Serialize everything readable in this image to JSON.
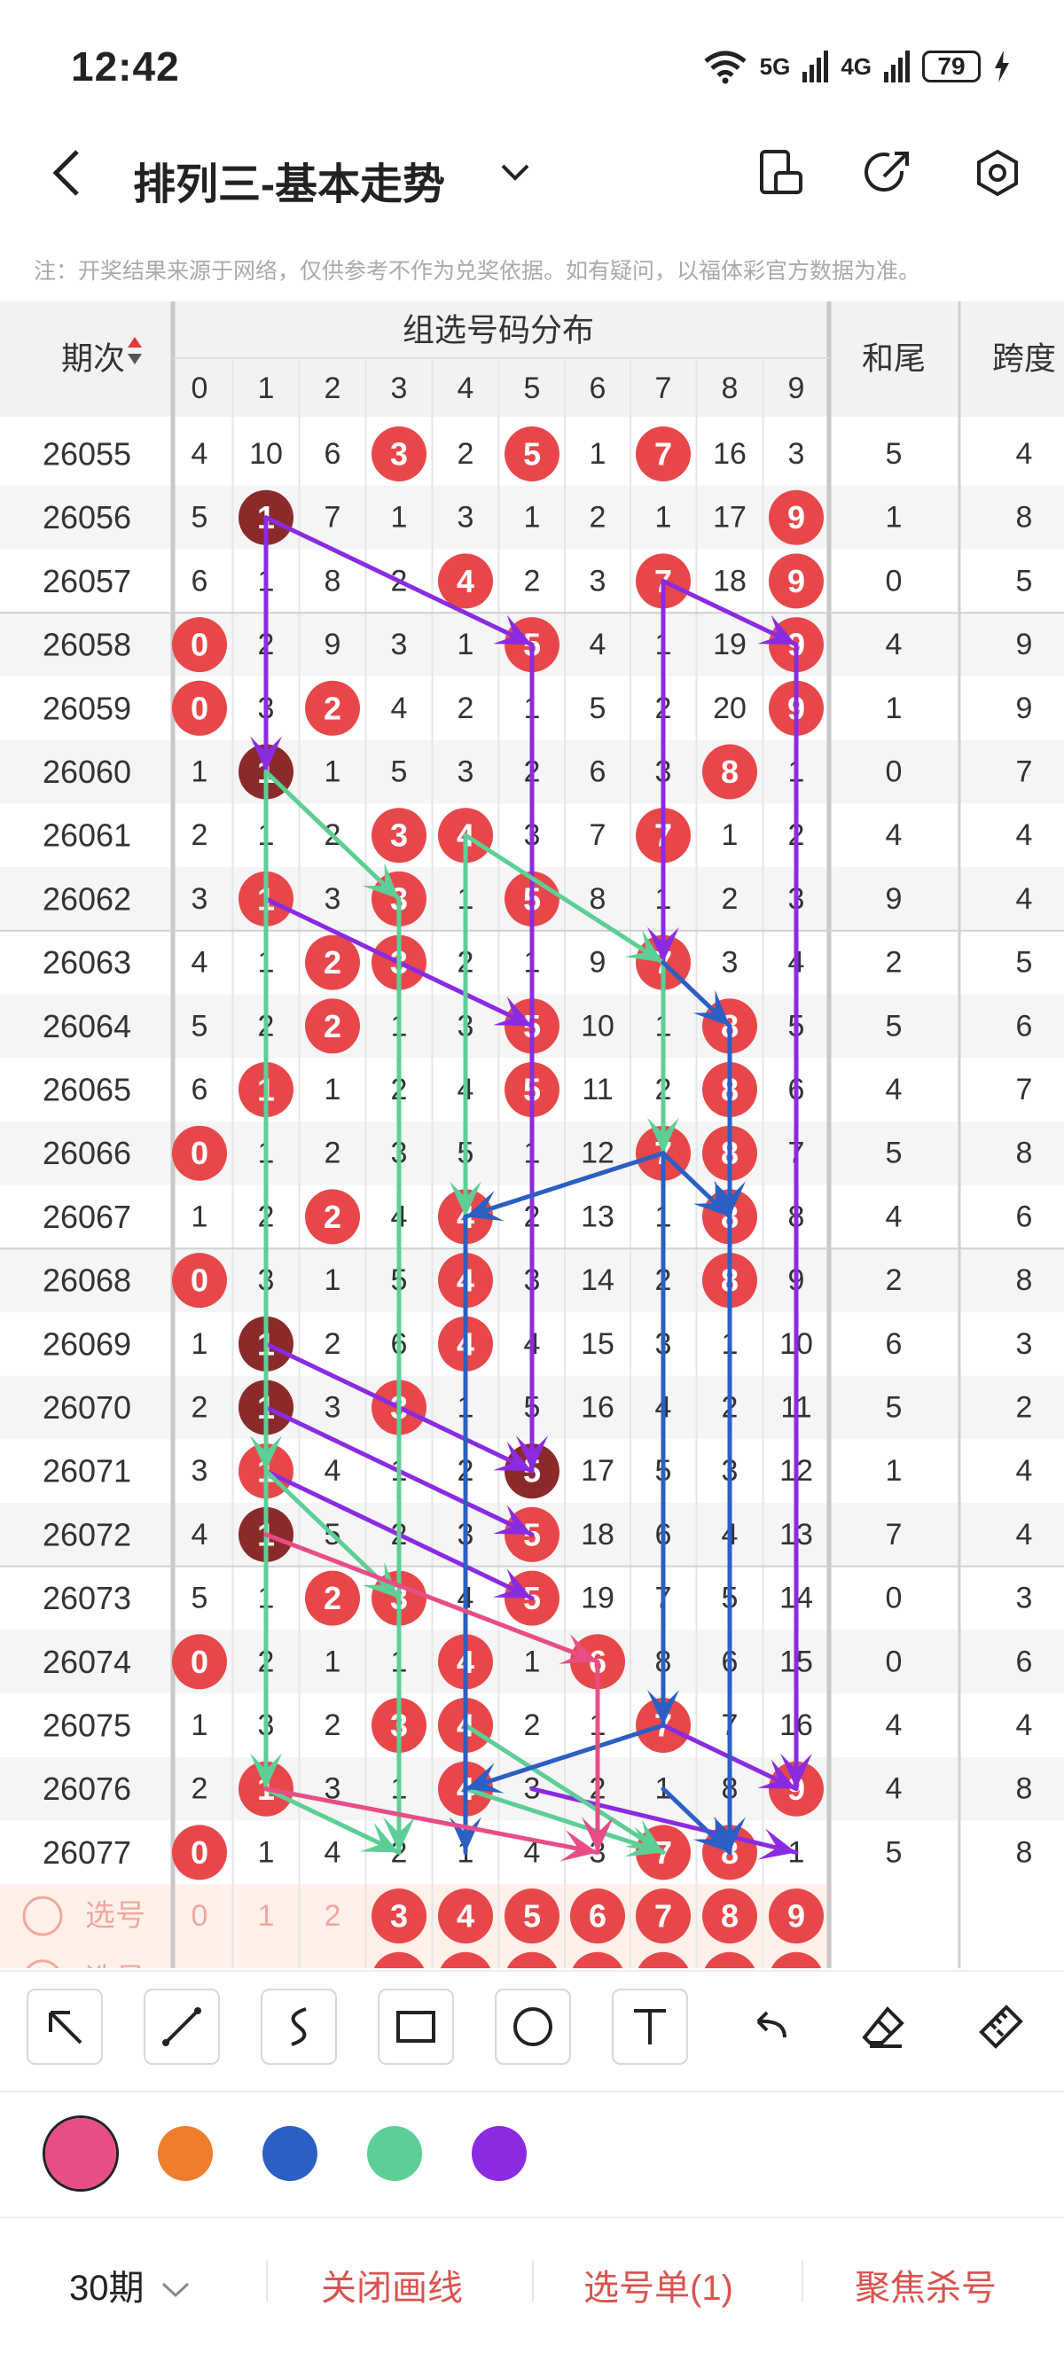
{
  "status": {
    "time": "12:42",
    "net1": "5G",
    "net2": "4G",
    "battery": "79"
  },
  "nav": {
    "title": "排列三-基本走势"
  },
  "disclaimer": "注：开奖结果来源于网络，仅供参考不作为兑奖依据。如有疑问，以福体彩官方数据为准。",
  "table": {
    "issue_header": "期次",
    "group_header": "组选号码分布",
    "sum_header": "和尾",
    "span_header": "跨度",
    "digits": [
      "0",
      "1",
      "2",
      "3",
      "4",
      "5",
      "6",
      "7",
      "8",
      "9"
    ],
    "rows": [
      {
        "issue": "26055",
        "cells": [
          4,
          10,
          6,
          "H",
          2,
          "H",
          1,
          "H",
          16,
          3
        ],
        "sum": 5,
        "span": 4
      },
      {
        "issue": "26056",
        "cells": [
          5,
          "D",
          7,
          1,
          3,
          1,
          2,
          1,
          17,
          "H"
        ],
        "sum": 1,
        "span": 8
      },
      {
        "issue": "26057",
        "cells": [
          6,
          1,
          8,
          2,
          "H",
          2,
          3,
          "H",
          18,
          "H"
        ],
        "sum": 0,
        "span": 5
      },
      {
        "issue": "26058",
        "cells": [
          "H",
          2,
          9,
          3,
          1,
          "H",
          4,
          1,
          19,
          "H"
        ],
        "sum": 4,
        "span": 9
      },
      {
        "issue": "26059",
        "cells": [
          "H",
          3,
          "H",
          4,
          2,
          1,
          5,
          2,
          20,
          "H"
        ],
        "sum": 1,
        "span": 9
      },
      {
        "issue": "26060",
        "cells": [
          1,
          "D",
          1,
          5,
          3,
          2,
          6,
          3,
          "H",
          1
        ],
        "sum": 0,
        "span": 7
      },
      {
        "issue": "26061",
        "cells": [
          2,
          1,
          2,
          "H",
          "H",
          3,
          7,
          "H",
          1,
          2
        ],
        "sum": 4,
        "span": 4
      },
      {
        "issue": "26062",
        "cells": [
          3,
          "H",
          3,
          "H",
          1,
          "H",
          8,
          1,
          2,
          3
        ],
        "sum": 9,
        "span": 4
      },
      {
        "issue": "26063",
        "cells": [
          4,
          1,
          "H",
          "H",
          2,
          1,
          9,
          "H",
          3,
          4
        ],
        "sum": 2,
        "span": 5
      },
      {
        "issue": "26064",
        "cells": [
          5,
          2,
          "H",
          1,
          3,
          "H",
          10,
          1,
          "H",
          5
        ],
        "sum": 5,
        "span": 6
      },
      {
        "issue": "26065",
        "cells": [
          6,
          "H",
          1,
          2,
          4,
          "H",
          11,
          2,
          "H",
          6
        ],
        "sum": 4,
        "span": 7
      },
      {
        "issue": "26066",
        "cells": [
          "H",
          1,
          2,
          3,
          5,
          1,
          12,
          "H",
          "H",
          7
        ],
        "sum": 5,
        "span": 8
      },
      {
        "issue": "26067",
        "cells": [
          1,
          2,
          "H",
          4,
          "H",
          2,
          13,
          1,
          "H",
          8
        ],
        "sum": 4,
        "span": 6
      },
      {
        "issue": "26068",
        "cells": [
          "H",
          3,
          1,
          5,
          "H",
          3,
          14,
          2,
          "H",
          9
        ],
        "sum": 2,
        "span": 8
      },
      {
        "issue": "26069",
        "cells": [
          1,
          "D",
          2,
          6,
          "H",
          4,
          15,
          3,
          1,
          10
        ],
        "sum": 6,
        "span": 3
      },
      {
        "issue": "26070",
        "cells": [
          2,
          "D",
          3,
          "H",
          1,
          5,
          16,
          4,
          2,
          11
        ],
        "sum": 5,
        "span": 2
      },
      {
        "issue": "26071",
        "cells": [
          3,
          "H",
          4,
          1,
          2,
          "D",
          17,
          5,
          3,
          12
        ],
        "sum": 1,
        "span": 4
      },
      {
        "issue": "26072",
        "cells": [
          4,
          "D",
          5,
          2,
          3,
          "H",
          18,
          6,
          4,
          13
        ],
        "sum": 7,
        "span": 4
      },
      {
        "issue": "26073",
        "cells": [
          5,
          1,
          "H",
          "H",
          4,
          "H",
          19,
          7,
          5,
          14
        ],
        "sum": 0,
        "span": 3
      },
      {
        "issue": "26074",
        "cells": [
          "H",
          2,
          1,
          1,
          "H",
          1,
          "H",
          8,
          6,
          15
        ],
        "sum": 0,
        "span": 6
      },
      {
        "issue": "26075",
        "cells": [
          1,
          3,
          2,
          "H",
          "H",
          2,
          1,
          "H",
          7,
          16
        ],
        "sum": 4,
        "span": 4
      },
      {
        "issue": "26076",
        "cells": [
          2,
          "H",
          3,
          1,
          "H",
          3,
          2,
          1,
          8,
          "H"
        ],
        "sum": 4,
        "span": 8
      },
      {
        "issue": "26077",
        "cells": [
          "H",
          1,
          4,
          2,
          1,
          4,
          3,
          "H",
          "H",
          1
        ],
        "sum": 5,
        "span": 8
      }
    ],
    "select_label": "选号",
    "select_digits": [
      "0",
      "1",
      "2",
      "3",
      "4",
      "5",
      "6",
      "7",
      "8",
      "9"
    ],
    "select_highlight": [
      3,
      4,
      5,
      6,
      7,
      8,
      9
    ]
  },
  "drawing_colors": [
    "#e84d86",
    "#ef7d2c",
    "#2b5fc4",
    "#5dcf96",
    "#8a2be2"
  ],
  "lines": [
    {
      "color": "purple",
      "from": [
        1,
        1
      ],
      "to": [
        3,
        5
      ]
    },
    {
      "color": "purple",
      "from": [
        1,
        1
      ],
      "to": [
        5,
        1
      ]
    },
    {
      "color": "purple",
      "from": [
        2,
        7
      ],
      "to": [
        3,
        9
      ]
    },
    {
      "color": "purple",
      "from": [
        2,
        7
      ],
      "to": [
        8,
        7
      ]
    },
    {
      "color": "purple",
      "from": [
        3,
        9
      ],
      "to": [
        21,
        9
      ]
    },
    {
      "color": "purple",
      "from": [
        7,
        1
      ],
      "to": [
        9,
        5
      ]
    },
    {
      "color": "purple",
      "from": [
        3,
        5
      ],
      "to": [
        16,
        5
      ]
    },
    {
      "color": "purple",
      "from": [
        14,
        1
      ],
      "to": [
        16,
        5
      ]
    },
    {
      "color": "purple",
      "from": [
        15,
        1
      ],
      "to": [
        17,
        5
      ]
    },
    {
      "color": "purple",
      "from": [
        16,
        1
      ],
      "to": [
        18,
        5
      ]
    },
    {
      "color": "purple",
      "from": [
        20,
        7
      ],
      "to": [
        21,
        9
      ]
    },
    {
      "color": "purple",
      "from": [
        21,
        5
      ],
      "to": [
        22,
        9
      ]
    },
    {
      "color": "green",
      "from": [
        5,
        1
      ],
      "to": [
        16,
        1
      ]
    },
    {
      "color": "green",
      "from": [
        5,
        1
      ],
      "to": [
        7,
        3
      ]
    },
    {
      "color": "green",
      "from": [
        6,
        4
      ],
      "to": [
        8,
        7
      ]
    },
    {
      "color": "green",
      "from": [
        7,
        3
      ],
      "to": [
        22,
        3
      ]
    },
    {
      "color": "green",
      "from": [
        6,
        4
      ],
      "to": [
        12,
        4
      ]
    },
    {
      "color": "green",
      "from": [
        8,
        7
      ],
      "to": [
        11,
        7
      ]
    },
    {
      "color": "green",
      "from": [
        16,
        1
      ],
      "to": [
        18,
        3
      ]
    },
    {
      "color": "green",
      "from": [
        16,
        1
      ],
      "to": [
        21,
        1
      ]
    },
    {
      "color": "green",
      "from": [
        20,
        4
      ],
      "to": [
        22,
        7
      ]
    },
    {
      "color": "green",
      "from": [
        21,
        1
      ],
      "to": [
        22,
        3
      ]
    },
    {
      "color": "green",
      "from": [
        21,
        4
      ],
      "to": [
        22,
        7
      ]
    },
    {
      "color": "blue",
      "from": [
        8,
        7
      ],
      "to": [
        9,
        8
      ]
    },
    {
      "color": "blue",
      "from": [
        9,
        8
      ],
      "to": [
        12,
        8
      ]
    },
    {
      "color": "blue",
      "from": [
        11,
        7
      ],
      "to": [
        12,
        4
      ]
    },
    {
      "color": "blue",
      "from": [
        11,
        7
      ],
      "to": [
        12,
        8
      ]
    },
    {
      "color": "blue",
      "from": [
        12,
        4
      ],
      "to": [
        22,
        4
      ]
    },
    {
      "color": "blue",
      "from": [
        11,
        7
      ],
      "to": [
        20,
        7
      ]
    },
    {
      "color": "blue",
      "from": [
        20,
        7
      ],
      "to": [
        21,
        4
      ]
    },
    {
      "color": "blue",
      "from": [
        12,
        8
      ],
      "to": [
        22,
        8
      ]
    },
    {
      "color": "blue",
      "from": [
        21,
        7
      ],
      "to": [
        22,
        8
      ]
    },
    {
      "color": "pink",
      "from": [
        17,
        1
      ],
      "to": [
        19,
        6
      ]
    },
    {
      "color": "pink",
      "from": [
        19,
        6
      ],
      "to": [
        22,
        6
      ]
    },
    {
      "color": "pink",
      "from": [
        21,
        1
      ],
      "to": [
        22,
        6
      ]
    }
  ],
  "tools": [
    "arrow-tool",
    "line-tool",
    "curve-tool",
    "rectangle-tool",
    "circle-tool",
    "text-tool",
    "undo-tool",
    "eraser-tool",
    "ruler-tool"
  ],
  "bottom": {
    "period": "30期",
    "close": "关闭画线",
    "ticket": "选号单(1)",
    "focus": "聚焦杀号"
  }
}
